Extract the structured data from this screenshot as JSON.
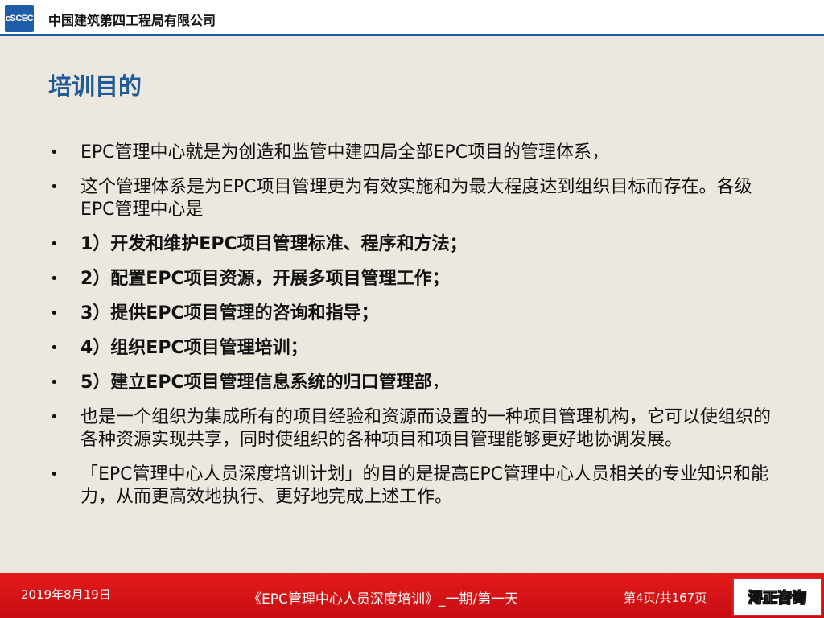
{
  "header": {
    "logo_text": "cSCEC",
    "company": "中国建筑第四工程局有限公司"
  },
  "title": "培训目的",
  "bullets": [
    {
      "text": "EPC管理中心就是为创造和监管中建四局全部EPC项目的管理体系，",
      "bold": false
    },
    {
      "text": "这个管理体系是为EPC项目管理更为有效实施和为最大程度达到组织目标而存在。各级EPC管理中心是",
      "bold": false
    },
    {
      "text": "1）开发和维护EPC项目管理标准、程序和方法；",
      "bold": true
    },
    {
      "text": "2）配置EPC项目资源，开展多项目管理工作；",
      "bold": true
    },
    {
      "text": "3）提供EPC项目管理的咨询和指导；",
      "bold": true
    },
    {
      "text": "4）组织EPC项目管理培训；",
      "bold": true
    },
    {
      "text": "5）建立EPC项目管理信息系统的归口管理部",
      "bold": true,
      "trail": "，"
    },
    {
      "text": "也是一个组织为集成所有的项目经验和资源而设置的一种项目管理机构，它可以使组织的各种资源实现共享，同时使组织的各种项目和项目管理能够更好地协调发展。",
      "bold": false
    },
    {
      "text": "「EPC管理中心人员深度培训计划」的目的是提高EPC管理中心人员相关的专业知识和能力，从而更高效地执行、更好地完成上述工作。",
      "bold": false
    }
  ],
  "footer": {
    "date": "2019年8月19日",
    "course": "《EPC管理中心人员深度培训》_一期/第一天",
    "page": "第4页/共167页",
    "badge": "浔正咨询"
  }
}
